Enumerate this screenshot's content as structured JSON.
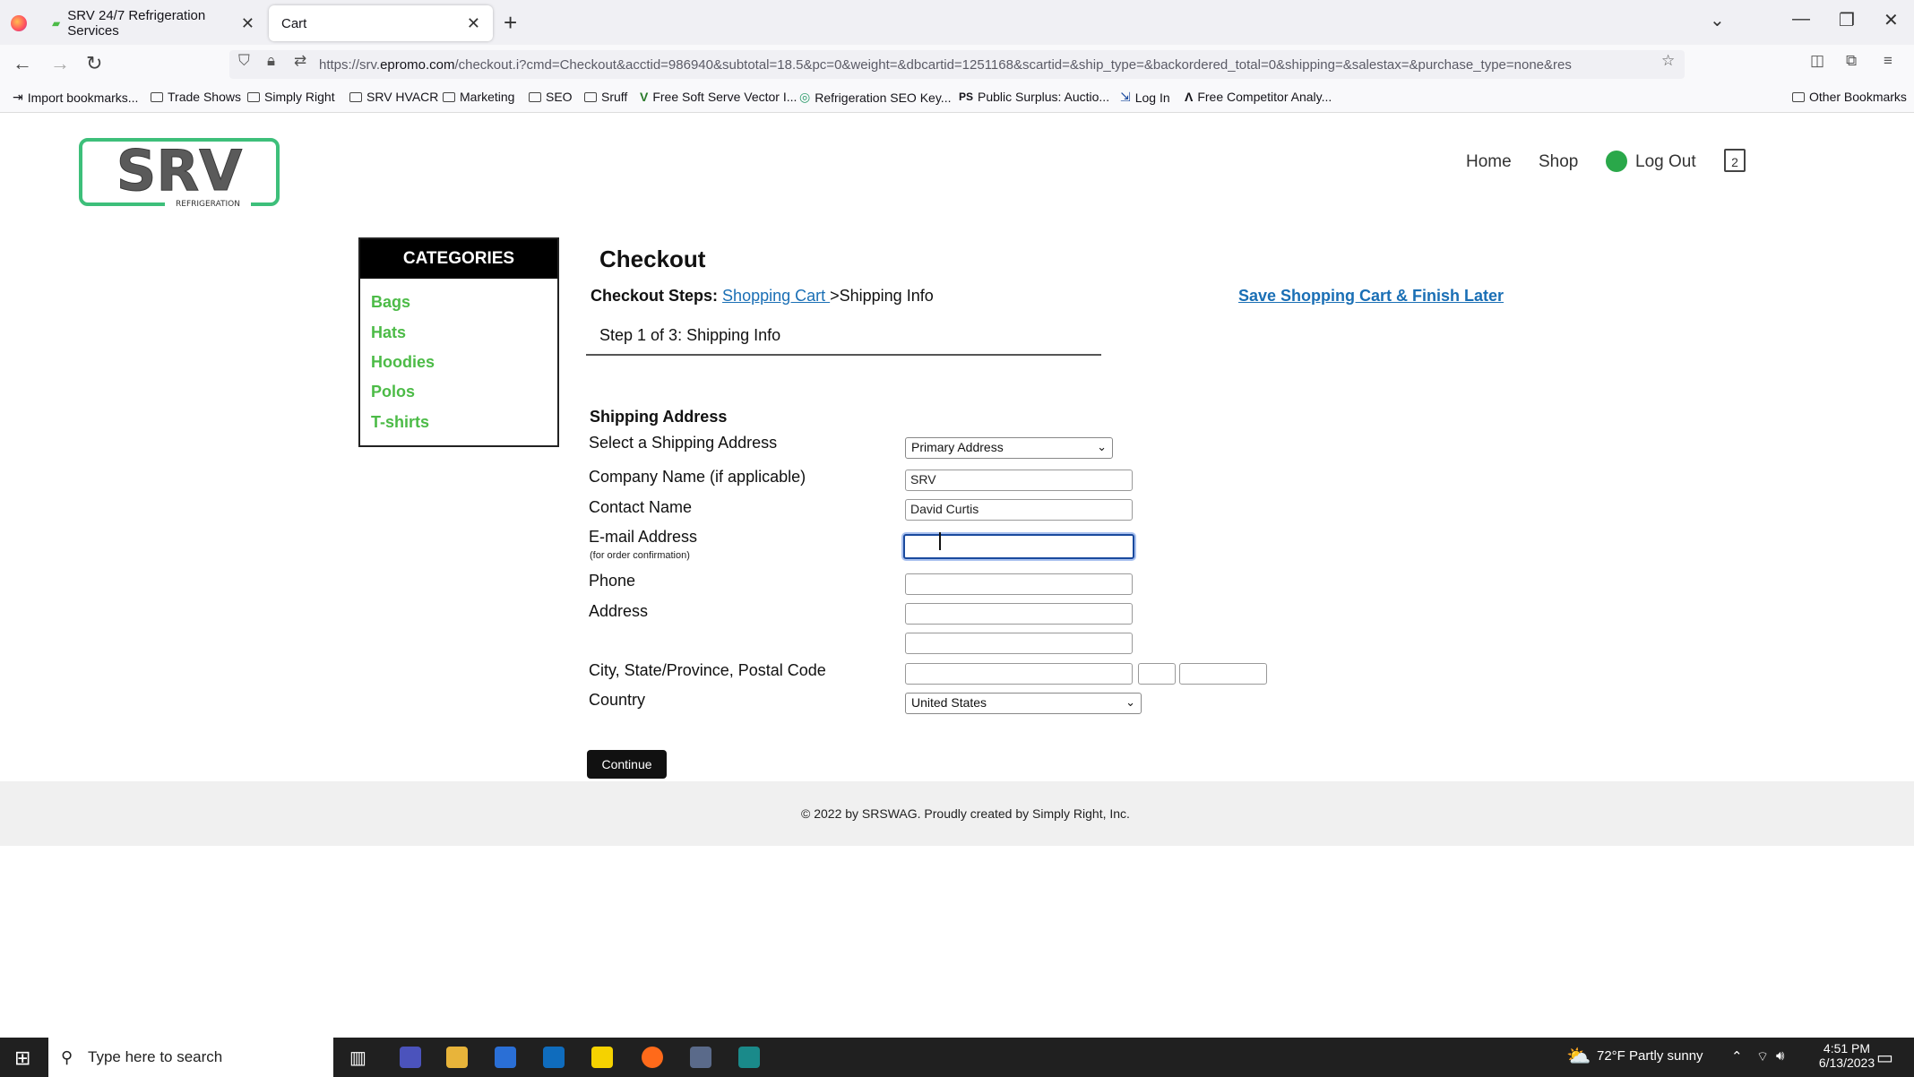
{
  "browser": {
    "tabs": [
      {
        "label": "SRV 24/7 Refrigeration Services"
      },
      {
        "label": "Cart"
      }
    ],
    "url_prefix": "https://srv.",
    "url_domain": "epromo.com",
    "url_rest": "/checkout.i?cmd=Checkout&acctid=986940&subtotal=18.5&pc=0&weight=&dbcartid=1251168&scartid=&ship_type=&backordered_total=0&shipping=&salestax=&purchase_type=none&res",
    "bookmarks": [
      "Import bookmarks...",
      "Trade Shows",
      "Simply Right",
      "SRV HVACR",
      "Marketing",
      "SEO",
      "Sruff",
      "Free Soft Serve Vector I...",
      "Refrigeration SEO Key...",
      "Public Surplus: Auctio...",
      "Log In",
      "Free Competitor Analy..."
    ],
    "other_bookmarks": "Other Bookmarks"
  },
  "site": {
    "logo_text": "SRV",
    "logo_sub": "REFRIGERATION",
    "nav": {
      "home": "Home",
      "shop": "Shop",
      "logout": "Log Out",
      "cart_count": "2"
    }
  },
  "categories": {
    "heading": "CATEGORIES",
    "items": [
      "Bags",
      "Hats",
      "Hoodies",
      "Polos",
      "T-shirts"
    ]
  },
  "checkout": {
    "title": "Checkout",
    "steps_label": "Checkout Steps:",
    "step_link": "Shopping Cart ",
    "step_current": ">Shipping Info",
    "save_link": "Save Shopping Cart & Finish Later",
    "step_info": "Step 1 of 3: Shipping Info",
    "section": "Shipping Address",
    "labels": {
      "select_address": "Select a Shipping Address",
      "company": "Company Name (if applicable)",
      "contact": "Contact Name",
      "email": "E-mail Address",
      "email_note": "(for order confirmation)",
      "phone": "Phone",
      "address": "Address",
      "city": "City, State/Province, Postal Code",
      "country": "Country"
    },
    "values": {
      "select_address": "Primary Address",
      "company": "SRV",
      "contact": "David Curtis",
      "email": "",
      "phone": "",
      "address1": "",
      "address2": "",
      "city": "",
      "state": "",
      "zip": "",
      "country": "United States"
    },
    "continue": "Continue"
  },
  "footer": "© 2022 by SRSWAG. Proudly created by Simply Right, Inc.",
  "taskbar": {
    "search_placeholder": "Type here to search",
    "weather": "72°F  Partly sunny",
    "time": "4:51 PM",
    "date": "6/13/2023"
  }
}
